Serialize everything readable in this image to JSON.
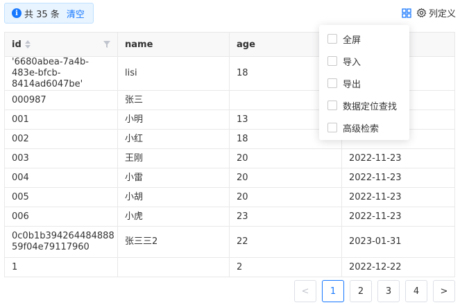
{
  "info": {
    "icon": "i",
    "text": "共 35 条",
    "clear_label": "清空"
  },
  "toolbar": {
    "column_settings_label": "列定义"
  },
  "table": {
    "columns": [
      "id",
      "name",
      "age",
      ""
    ],
    "rows": [
      [
        "'6680abea-7a4b-483e-bfcb-8414ad6047be'",
        "lisi",
        "18",
        ""
      ],
      [
        "000987",
        "张三",
        "",
        ""
      ],
      [
        "001",
        "小明",
        "13",
        ""
      ],
      [
        "002",
        "小红",
        "18",
        ""
      ],
      [
        "003",
        "王刚",
        "20",
        "2022-11-23"
      ],
      [
        "004",
        "小雷",
        "20",
        "2022-11-23"
      ],
      [
        "005",
        "小胡",
        "20",
        "2022-11-23"
      ],
      [
        "006",
        "小虎",
        "23",
        "2022-11-23"
      ],
      [
        "0c0b1b394264484888 59f04e79117960",
        "张三三2",
        "22",
        "2023-01-31"
      ],
      [
        "1",
        "",
        "2",
        "2022-12-22"
      ]
    ]
  },
  "dropdown": {
    "items": [
      "全屏",
      "导入",
      "导出",
      "数据定位查找",
      "高级检索"
    ]
  },
  "pagination": {
    "prev": "<",
    "pages": [
      "1",
      "2",
      "3",
      "4"
    ],
    "current": "1",
    "next": ">"
  },
  "colors": {
    "accent": "#1677ff",
    "header_bg": "#f8f8f9",
    "border": "#e8e8e8"
  }
}
